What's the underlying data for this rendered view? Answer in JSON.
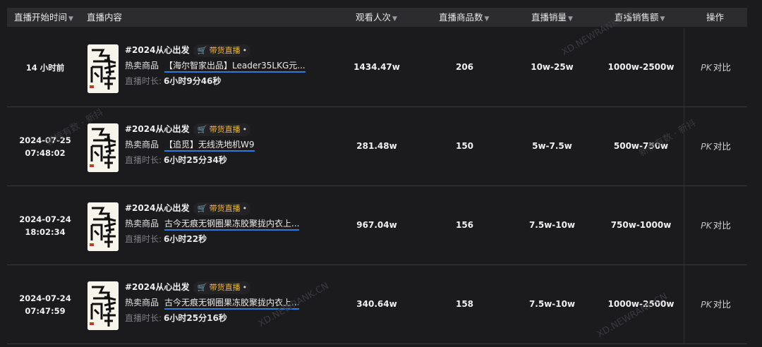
{
  "header": {
    "start_time": "直播开始时间",
    "content": "直播内容",
    "viewers": "观看人次",
    "products": "直播商品数",
    "sales": "直播销量",
    "revenue": "直播销售额",
    "action": "操作"
  },
  "rows": [
    {
      "time1": "14 小时前",
      "time2": "",
      "title": "#2024从心出发",
      "tag": "带货直播",
      "hot_label": "热卖商品",
      "hot_value": "【海尔智家出品】Leader35LKG元...",
      "dur_label": "直播时长:",
      "dur_value": "6小时9分46秒",
      "viewers": "1434.47w",
      "products": "206",
      "sales": "10w-25w",
      "revenue": "1000w-2500w",
      "pk": "PK",
      "compare": "对比"
    },
    {
      "time1": "2024-07-25",
      "time2": "07:48:02",
      "title": "#2024从心出发",
      "tag": "带货直播",
      "hot_label": "热卖商品",
      "hot_value": "【追觅】无线洗地机W9",
      "dur_label": "直播时长:",
      "dur_value": "6小时25分34秒",
      "viewers": "281.48w",
      "products": "150",
      "sales": "5w-7.5w",
      "revenue": "500w-750w",
      "pk": "PK",
      "compare": "对比"
    },
    {
      "time1": "2024-07-24",
      "time2": "18:02:34",
      "title": "#2024从心出发",
      "tag": "带货直播",
      "hot_label": "热卖商品",
      "hot_value": "古今无痕无钢圈果冻胶聚拢内衣上...",
      "dur_label": "直播时长:",
      "dur_value": "6小时22秒",
      "viewers": "967.04w",
      "products": "156",
      "sales": "7.5w-10w",
      "revenue": "750w-1000w",
      "pk": "PK",
      "compare": "对比"
    },
    {
      "time1": "2024-07-24",
      "time2": "07:47:59",
      "title": "#2024从心出发",
      "tag": "带货直播",
      "hot_label": "热卖商品",
      "hot_value": "古今无痕无钢圈果冻胶聚拢内衣上...",
      "dur_label": "直播时长:",
      "dur_value": "6小时25分16秒",
      "viewers": "340.64w",
      "products": "158",
      "sales": "7.5w-10w",
      "revenue": "1000w-2500w",
      "pk": "PK",
      "compare": "对比"
    }
  ],
  "thumbnail": {
    "glyphs": [
      "与",
      "辉",
      "同",
      "行"
    ]
  },
  "watermarks": [
    "XD.NEWRANK.CN",
    "新榜有数 · 新抖"
  ],
  "colors": {
    "accent_underline": "#2b7be0",
    "tag_text": "#f3b73a",
    "background": "#1b1b1d",
    "header_bg": "#2c2c2f"
  }
}
